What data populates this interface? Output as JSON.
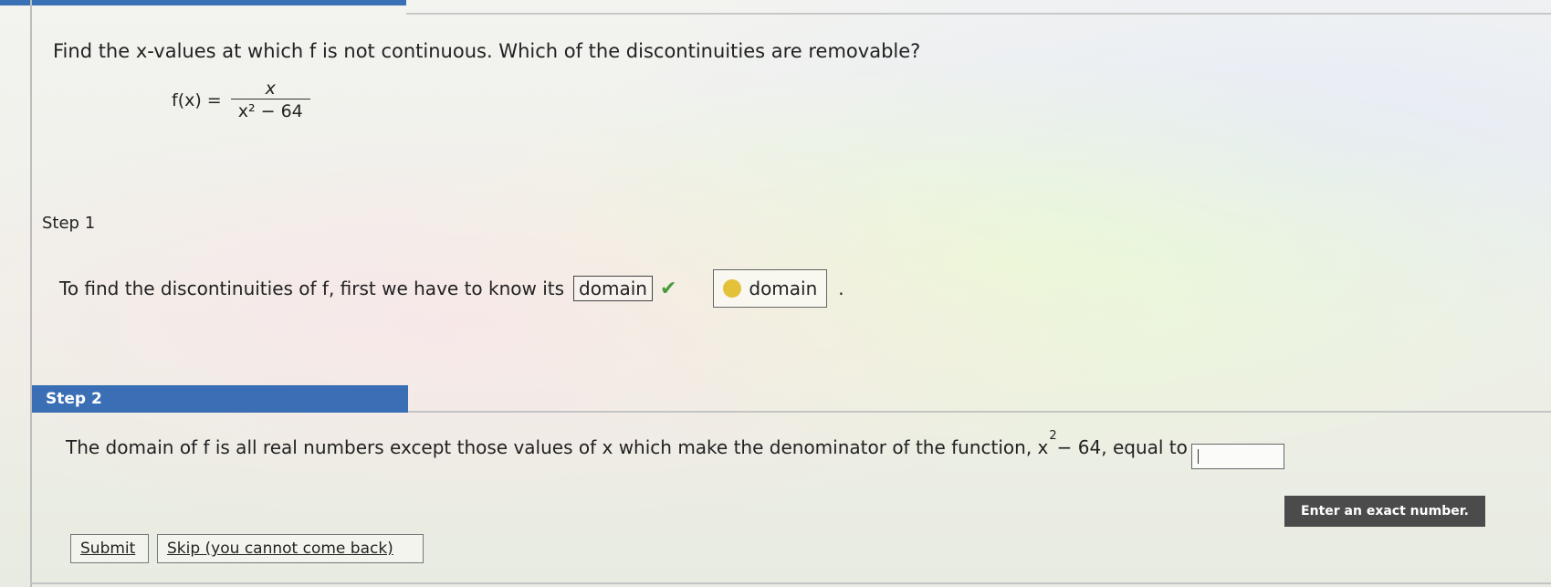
{
  "question": {
    "text": "Find the x-values at which f is not continuous. Which of the discontinuities are removable?",
    "formula": {
      "lhs": "f(x) =",
      "numerator": "x",
      "denominator": "x² − 64"
    }
  },
  "step1": {
    "label": "Step 1",
    "text": "To find the discontinuities of f, first we have to know its",
    "answer": "domain",
    "hint": "domain",
    "period": "."
  },
  "step2": {
    "header": "Step 2",
    "text_before": "The domain of f is all real numbers except those values of x which make the denominator of the function, x",
    "sup": "2",
    "text_after": " − 64, equal to",
    "input_value": "",
    "tooltip": "Enter an exact number."
  },
  "buttons": {
    "submit": "Submit",
    "skip": "Skip (you cannot come back)"
  }
}
